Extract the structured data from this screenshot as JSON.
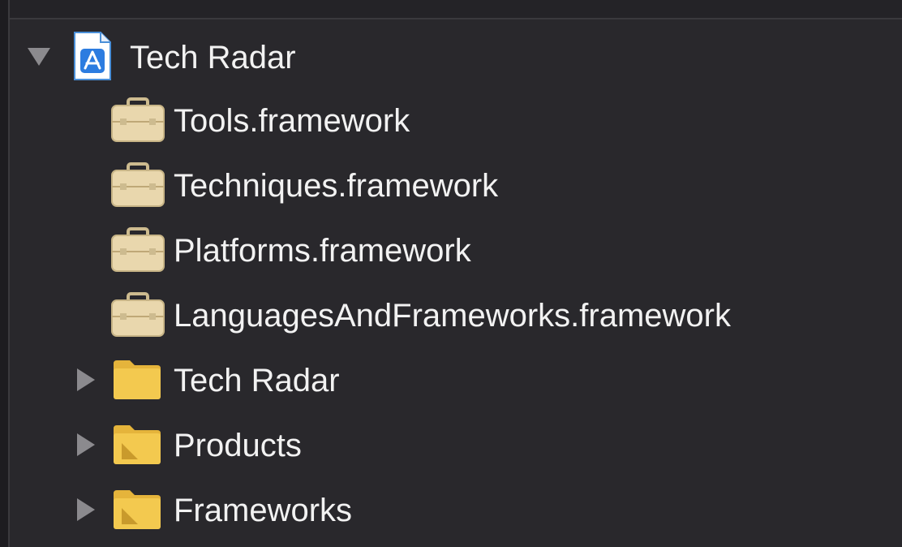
{
  "tree": {
    "project": {
      "label": "Tech Radar",
      "expanded": true,
      "icon": "xcode-project-icon"
    },
    "frameworks": [
      {
        "label": "Tools.framework",
        "icon": "framework-toolbox-icon"
      },
      {
        "label": "Techniques.framework",
        "icon": "framework-toolbox-icon"
      },
      {
        "label": "Platforms.framework",
        "icon": "framework-toolbox-icon"
      },
      {
        "label": "LanguagesAndFrameworks.framework",
        "icon": "framework-toolbox-icon"
      }
    ],
    "groups": [
      {
        "label": "Tech Radar",
        "expanded": false,
        "icon": "folder-icon"
      },
      {
        "label": "Products",
        "expanded": false,
        "icon": "folder-icon"
      },
      {
        "label": "Frameworks",
        "expanded": false,
        "icon": "folder-icon"
      }
    ]
  },
  "colors": {
    "background": "#29282c",
    "text": "#f2f2f2",
    "folder": "#f3c94f",
    "framework": "#e9d7ad",
    "disclosure": "#8b8a8e"
  }
}
